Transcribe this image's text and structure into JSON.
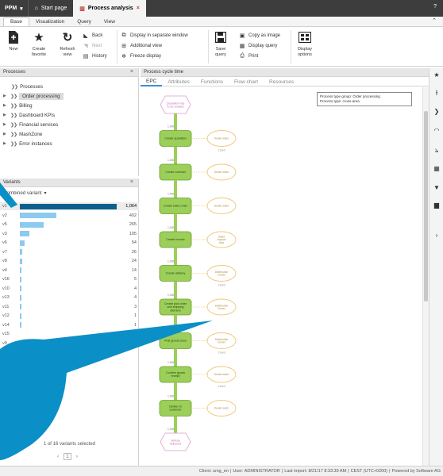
{
  "titlebar": {
    "app_label": "PPM",
    "tabs": [
      {
        "label": "Start page",
        "icon": "home-icon"
      },
      {
        "label": "Process analysis",
        "icon": "chart-icon",
        "close": "×"
      }
    ],
    "help": "?"
  },
  "ribbon_tabs": [
    "Base",
    "Visualization",
    "Query",
    "View"
  ],
  "ribbon": {
    "new": "New",
    "create_favorite": "Create\nfavorite",
    "refresh_view": "Refresh\nview",
    "back": "Back",
    "next": "Next",
    "history": "History",
    "display_separate": "Display in separate window",
    "additional_view": "Additional view",
    "freeze_display": "Freeze display",
    "save_query": "Save\nquery",
    "copy_image": "Copy as image",
    "display_query": "Display query",
    "print": "Print",
    "display_options": "Display\noptions"
  },
  "processes_panel": {
    "title": "Processes",
    "close": "×",
    "items": [
      {
        "label": "Processes",
        "level": 0
      },
      {
        "label": "Order processing",
        "level": 1,
        "selected": true
      },
      {
        "label": "Billing",
        "level": 1
      },
      {
        "label": "Dashboard KPIs",
        "level": 1
      },
      {
        "label": "Financial services",
        "level": 1
      },
      {
        "label": "MashZone",
        "level": 1
      },
      {
        "label": "Error instances",
        "level": 1
      }
    ]
  },
  "variants_panel": {
    "title": "Variants",
    "close": "×",
    "dropdown": "Combined variant",
    "rows": [
      {
        "name": "v1",
        "count": "1,064",
        "value": 1064,
        "selected": true
      },
      {
        "name": "v2",
        "count": "402",
        "value": 402
      },
      {
        "name": "v5",
        "count": "265",
        "value": 265
      },
      {
        "name": "v3",
        "count": "105",
        "value": 105
      },
      {
        "name": "v6",
        "count": "54",
        "value": 54
      },
      {
        "name": "v7",
        "count": "26",
        "value": 26
      },
      {
        "name": "v8",
        "count": "24",
        "value": 24
      },
      {
        "name": "v4",
        "count": "14",
        "value": 14
      },
      {
        "name": "v16",
        "count": "5",
        "value": 5
      },
      {
        "name": "v10",
        "count": "4",
        "value": 4
      },
      {
        "name": "v13",
        "count": "4",
        "value": 4
      },
      {
        "name": "v11",
        "count": "3",
        "value": 3
      },
      {
        "name": "v12",
        "count": "1",
        "value": 1
      },
      {
        "name": "v14",
        "count": "1",
        "value": 1
      },
      {
        "name": "v15",
        "count": "",
        "value": 0
      },
      {
        "name": "v9",
        "count": "",
        "value": 0
      }
    ],
    "selection_text": "1 of 16 variants selected",
    "pager_prev": "‹",
    "pager_page": "1",
    "pager_next": "›"
  },
  "main_panel": {
    "title": "Process cycle time",
    "tabs": [
      "EPC",
      "Attributes",
      "Functions",
      "Flow chart",
      "Resources"
    ],
    "active_tab": "EPC",
    "info_lines": [
      "Process type group: Order processing",
      "Process type: cross-area"
    ],
    "start_event": "Quotation has\nto be created",
    "end_event": "Vehicle\ndelivered",
    "steps": [
      {
        "fn": "Create quotation",
        "count": "1,000",
        "org": "Dealer sales",
        "x_label": "1'sand"
      },
      {
        "fn": "Create contract",
        "count": "1,000",
        "org": "Dealer sales",
        "x_label": ""
      },
      {
        "fn": "Create sales order",
        "count": "1,000",
        "org": "Dealer sales",
        "x_label": ""
      },
      {
        "fn": "Create invoice",
        "count": "1,000",
        "org": "Sales\nsupport\nAsst",
        "x_label": ""
      },
      {
        "fn": "Create delivery",
        "count": "1,000",
        "org": "Distribution\nCenter",
        "x_label": "1'sand"
      },
      {
        "fn": "Create pick order\nand shipping\nelement",
        "count": "1,000",
        "org": "Distribution\nCenter",
        "x_label": ""
      },
      {
        "fn": "Post goods issue",
        "count": "1,000",
        "org": "Distribution\nCenter",
        "x_label": "1'sand"
      },
      {
        "fn": "Confirm goods\nreceipt",
        "count": "1,000",
        "org": "Dealer sales",
        "x_label": "1'sand"
      },
      {
        "fn": "Deliver to\ncustomer",
        "count": "1,000",
        "org": "Dealer sales",
        "x_label": ""
      }
    ],
    "edge_counts": [
      "1,000",
      "1,000",
      "1,000",
      "1,000",
      "1,000",
      "1,000",
      "1,000",
      "1,000",
      "1,000",
      "1,000"
    ]
  },
  "status_bar": {
    "client": "Client: umg_en",
    "user": "User: ADMINISTRATOR",
    "last_import": "Last import: 8/21/17 8:33:39 AM",
    "tz": "CEST (UTC+0200)",
    "powered": "Powered by Software AG"
  },
  "colors": {
    "function_fill": "#9ccf5a",
    "function_stroke": "#6a9e2a",
    "org_stroke": "#f2c77a",
    "event_stroke": "#e6b0d6",
    "selected_bar": "#0e5f8c",
    "bar": "#8ccaf0",
    "callout": "#0b8fc7"
  }
}
